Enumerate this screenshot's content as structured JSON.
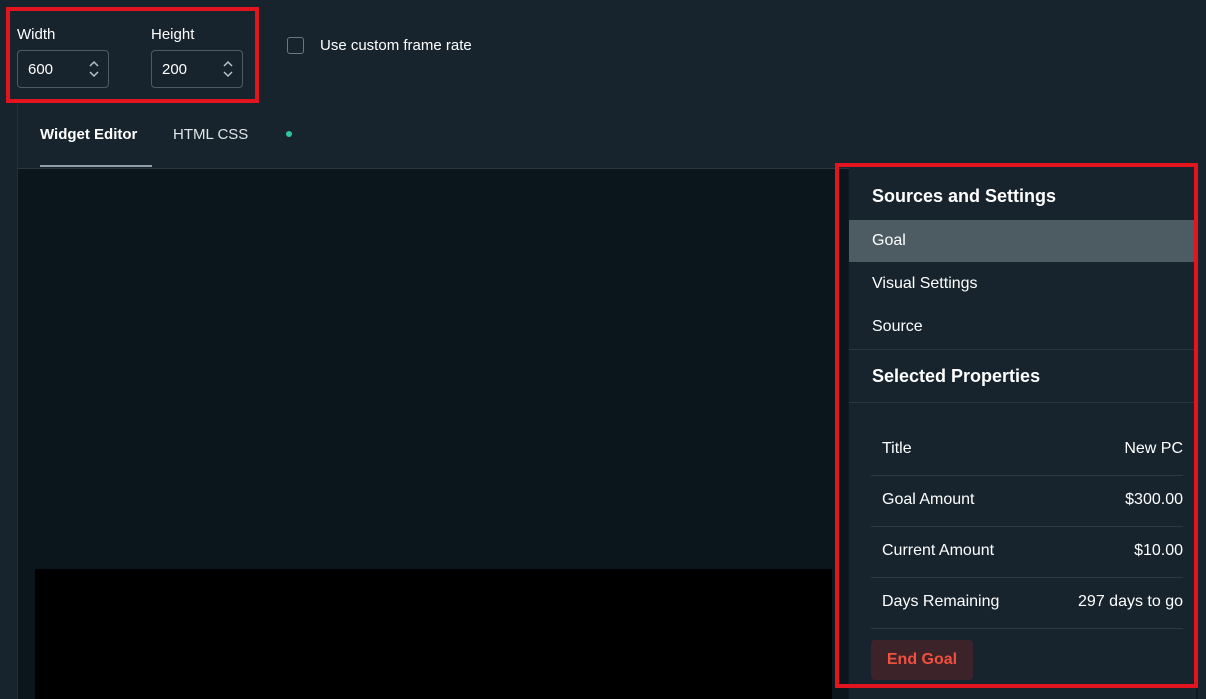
{
  "frame": {
    "width_label": "Width",
    "width_value": "600",
    "height_label": "Height",
    "height_value": "200",
    "custom_frame_rate_label": "Use custom frame rate",
    "custom_frame_rate_checked": false
  },
  "tabs": [
    {
      "label": "Widget Editor",
      "active": true
    },
    {
      "label": "HTML CSS",
      "active": false,
      "status_dot_color": "#31c3a2"
    }
  ],
  "panel": {
    "sources_title": "Sources and Settings",
    "nav_items": [
      {
        "label": "Goal",
        "selected": true
      },
      {
        "label": "Visual Settings",
        "selected": false
      },
      {
        "label": "Source",
        "selected": false
      }
    ],
    "properties_title": "Selected Properties",
    "properties": [
      {
        "key": "Title",
        "value": "New PC"
      },
      {
        "key": "Goal Amount",
        "value": "$300.00"
      },
      {
        "key": "Current Amount",
        "value": "$10.00"
      },
      {
        "key": "Days Remaining",
        "value": "297 days to go"
      }
    ],
    "end_goal_label": "End Goal"
  },
  "colors": {
    "highlight_red": "#e2151f",
    "danger_text": "#f0503e",
    "selected_item_bg": "#4d5b63",
    "background": "#17242d"
  }
}
